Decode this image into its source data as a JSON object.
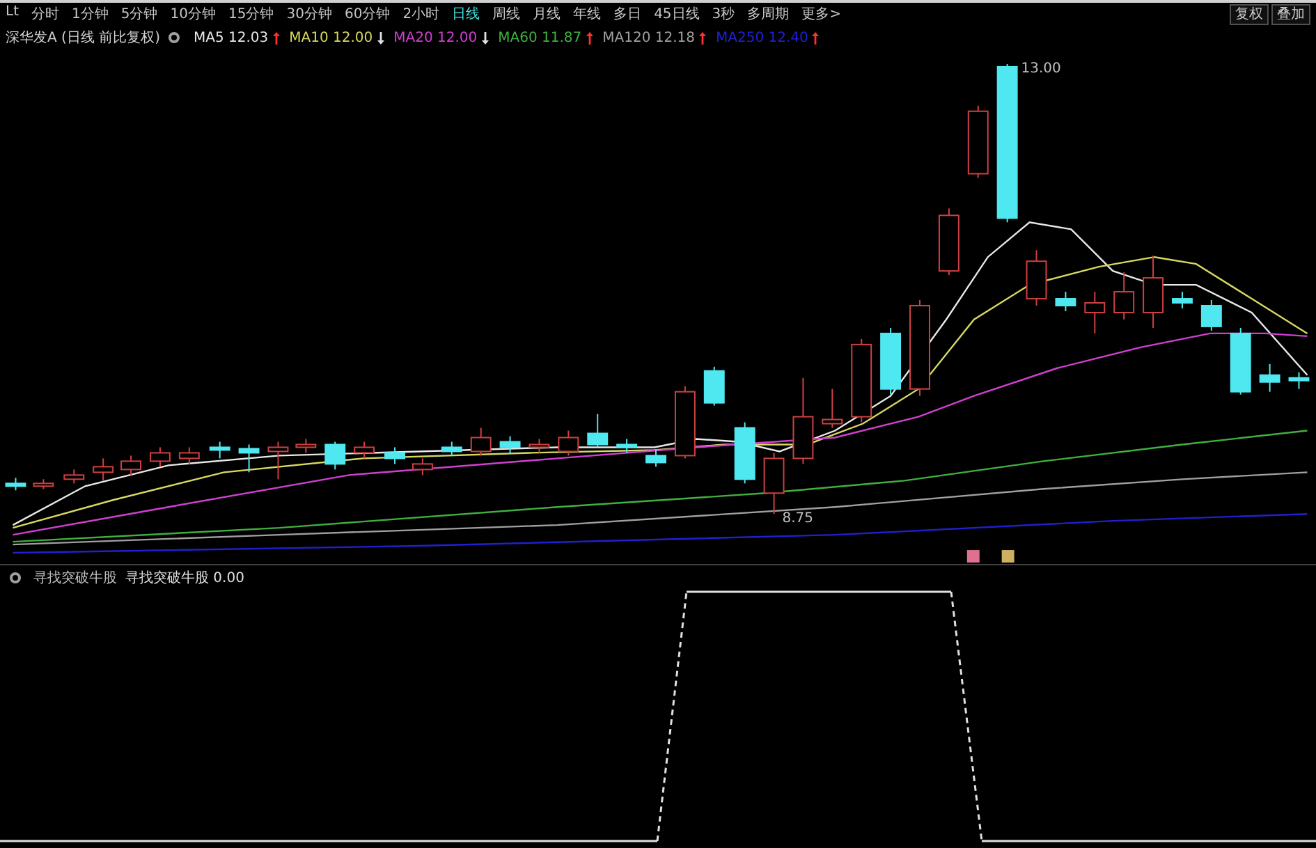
{
  "period_bar": {
    "items": [
      {
        "label": "Lt",
        "selected": false
      },
      {
        "label": "分时",
        "selected": false
      },
      {
        "label": "1分钟",
        "selected": false
      },
      {
        "label": "5分钟",
        "selected": false
      },
      {
        "label": "10分钟",
        "selected": false
      },
      {
        "label": "15分钟",
        "selected": false
      },
      {
        "label": "30分钟",
        "selected": false
      },
      {
        "label": "60分钟",
        "selected": false
      },
      {
        "label": "2小时",
        "selected": false
      },
      {
        "label": "日线",
        "selected": true
      },
      {
        "label": "周线",
        "selected": false
      },
      {
        "label": "月线",
        "selected": false
      },
      {
        "label": "年线",
        "selected": false
      },
      {
        "label": "多日",
        "selected": false
      },
      {
        "label": "45日线",
        "selected": false
      },
      {
        "label": "3秒",
        "selected": false
      },
      {
        "label": "多周期",
        "selected": false
      },
      {
        "label": "更多>",
        "selected": false
      }
    ],
    "buttons": [
      "复权",
      "叠加"
    ]
  },
  "legend": {
    "title": "深华发A (日线 前比复权)",
    "moving_averages": [
      {
        "label": "MA5",
        "value": "12.03",
        "color": "#e8e8e8",
        "rising": true
      },
      {
        "label": "MA10",
        "value": "12.00",
        "color": "#d8d860",
        "rising": false
      },
      {
        "label": "MA20",
        "value": "12.00",
        "color": "#d040d0",
        "rising": false
      },
      {
        "label": "MA60",
        "value": "11.87",
        "color": "#40b040",
        "rising": true
      },
      {
        "label": "MA120",
        "value": "12.18",
        "color": "#a0a0a0",
        "rising": true
      },
      {
        "label": "MA250",
        "value": "12.40",
        "color": "#2020d0",
        "rising": true
      }
    ]
  },
  "chart": {
    "high_label": "13.00",
    "low_label": "8.75"
  },
  "indicator": {
    "name": "寻找突破牛股",
    "line_label": "寻找突破牛股",
    "value": "0.00"
  }
}
